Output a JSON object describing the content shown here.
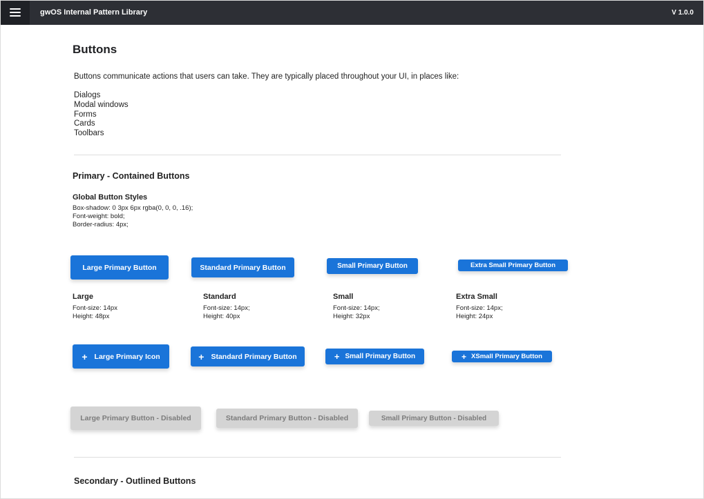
{
  "header": {
    "menu_icon": "hamburger-menu-icon",
    "app_title": "gwOS Internal Pattern Library",
    "version": "V 1.0.0"
  },
  "colors": {
    "topbar": "#2d2f35",
    "primary": "#1a74d9",
    "disabled_bg": "#d4d4d4",
    "disabled_text": "#7c7c7c"
  },
  "page": {
    "title": "Buttons",
    "intro": "Buttons communicate actions that users can take. They are typically placed throughout your UI, in places like:",
    "places": [
      "Dialogs",
      "Modal windows",
      "Forms",
      "Cards",
      "Toolbars"
    ]
  },
  "primary": {
    "heading": "Primary - Contained Buttons",
    "global_heading": "Global Button Styles",
    "global_lines": [
      "Box-shadow:  0 3px 6px rgba(0, 0, 0, .16);",
      "Font-weight: bold;",
      "Border-radius: 4px;"
    ],
    "buttons": [
      "Large Primary Button",
      "Standard Primary Button",
      "Small Primary Button",
      "Extra Small Primary Button"
    ],
    "sizes": [
      {
        "title": "Large",
        "font": "Font-size: 14px",
        "height": "Height: 48px"
      },
      {
        "title": "Standard",
        "font": "Font-size: 14px;",
        "height": "Height: 40px"
      },
      {
        "title": "Small",
        "font": "Font-size: 14px;",
        "height": "Height: 32px"
      },
      {
        "title": "Extra Small",
        "font": "Font-size: 14px;",
        "height": "Height: 24px"
      }
    ],
    "icon_symbol": "+",
    "icon_buttons": [
      "Large Primary Icon",
      "Standard Primary Button",
      "Small Primary Button",
      "XSmall Primary Button"
    ],
    "disabled_buttons": [
      "Large Primary Button - Disabled",
      "Standard Primary Button - Disabled",
      "Small Primary Button - Disabled"
    ]
  },
  "secondary": {
    "heading": "Secondary - Outlined Buttons"
  }
}
